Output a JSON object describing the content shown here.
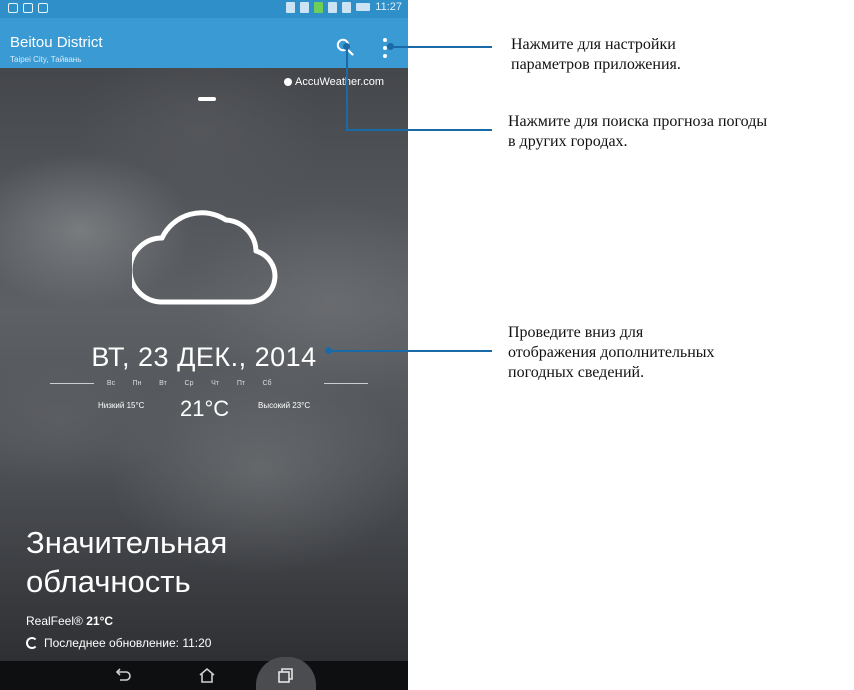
{
  "status_bar": {
    "time": "11:27"
  },
  "app_bar": {
    "city": "Beitou District",
    "region": "Taipei City, Тайвань"
  },
  "provider": "AccuWeather.com",
  "weather": {
    "date": "ВТ, 23 ДЕК., 2014",
    "weekdays": [
      "Вс",
      "Пн",
      "Вт",
      "Ср",
      "Чт",
      "Пт",
      "Сб"
    ],
    "low": "Низкий 15°C",
    "temperature": "21°C",
    "high": "Высокий 23°C",
    "condition_line1": "Значительная",
    "condition_line2": "облачность",
    "realfeel_label": "RealFeel®",
    "realfeel_value": "21°C",
    "last_update": "Последнее обновление: 11:20"
  },
  "callouts": {
    "settings_line1": "Нажмите для настройки",
    "settings_line2": "параметров приложения.",
    "search_line1": "Нажмите для поиска прогноза погоды",
    "search_line2": "в других городах.",
    "swipe_line1": "Проведите вниз для",
    "swipe_line2": "отображения дополнительных",
    "swipe_line3": "погодных сведений."
  },
  "colors": {
    "status_bar": "#2e8fc9",
    "app_bar": "#3a9ad4",
    "callout_line": "#1a6aa8"
  }
}
